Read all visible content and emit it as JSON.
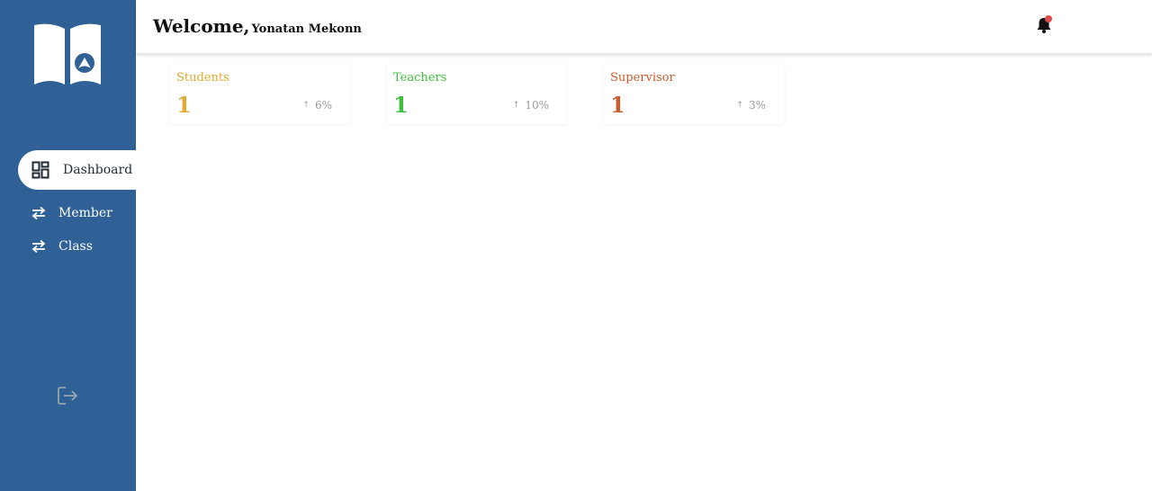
{
  "colors": {
    "sidebar": "#2f6196",
    "students": "#e0a92f",
    "teachers": "#3fbf3f",
    "supervisor": "#cc5a2e",
    "notification_dot": "#e24b4b"
  },
  "sidebar": {
    "logo_icon": "open-book-logo-icon",
    "items": [
      {
        "label": "Dashboard",
        "icon": "dashboard-grid-icon",
        "active": true
      },
      {
        "label": "Member",
        "icon": "swap-arrows-icon",
        "active": false
      },
      {
        "label": "Class",
        "icon": "swap-arrows-icon",
        "active": false
      }
    ],
    "logout_icon": "logout-icon"
  },
  "header": {
    "welcome": "Welcome,",
    "user_name": "Yonatan Mekonn",
    "notification_icon": "bell-icon"
  },
  "stats": [
    {
      "title": "Students",
      "value": "1",
      "change": "6%",
      "change_icon": "arrow-up-icon"
    },
    {
      "title": "Teachers",
      "value": "1",
      "change": "10%",
      "change_icon": "arrow-up-icon"
    },
    {
      "title": "Supervisor",
      "value": "1",
      "change": "3%",
      "change_icon": "arrow-up-icon"
    }
  ]
}
